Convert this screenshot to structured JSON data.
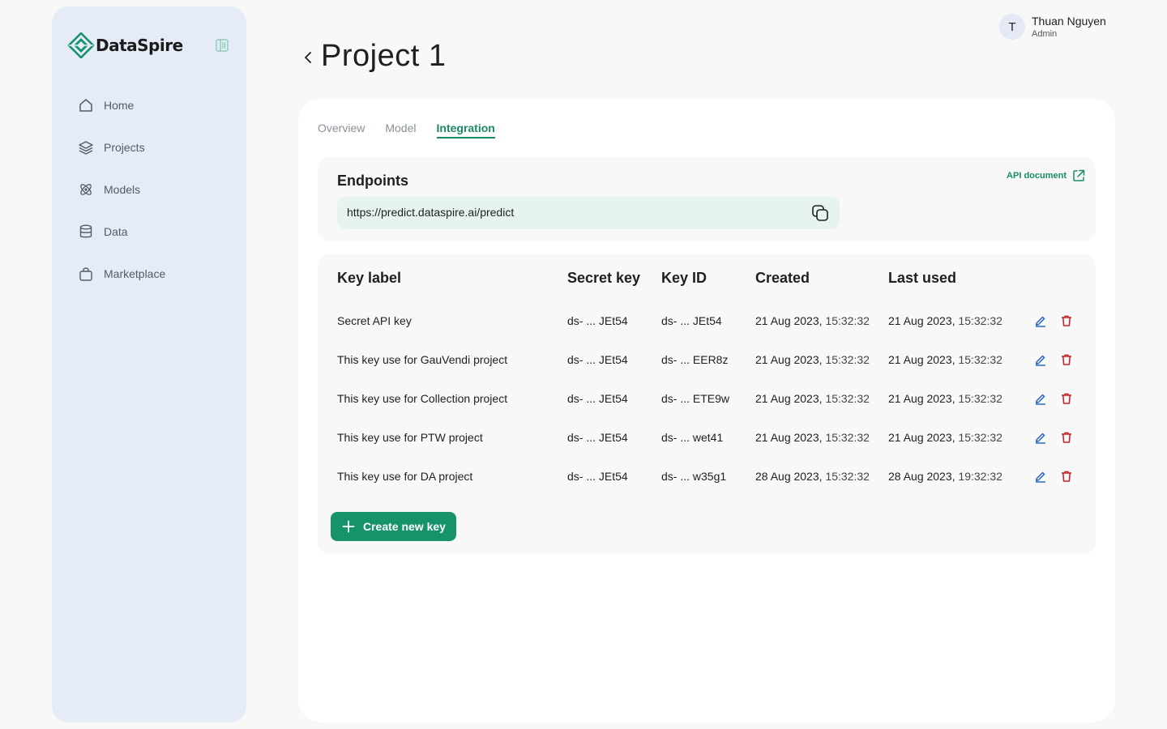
{
  "brand": {
    "name": "DataSpire",
    "accent": "#17936c",
    "danger": "#c62828",
    "link_blue": "#1e5fbf"
  },
  "sidebar": {
    "items": [
      {
        "label": "Home",
        "icon": "home-icon"
      },
      {
        "label": "Projects",
        "icon": "layers-icon"
      },
      {
        "label": "Models",
        "icon": "atom-icon"
      },
      {
        "label": "Data",
        "icon": "database-icon"
      },
      {
        "label": "Marketplace",
        "icon": "shopping-bag-icon"
      }
    ]
  },
  "header": {
    "title": "Project 1"
  },
  "user": {
    "initial": "T",
    "name": "Thuan Nguyen",
    "role": "Admin"
  },
  "tabs": [
    {
      "label": "Overview",
      "active": false
    },
    {
      "label": "Model",
      "active": false
    },
    {
      "label": "Integration",
      "active": true
    }
  ],
  "endpoints": {
    "title": "Endpoints",
    "url": "https://predict.dataspire.ai/predict",
    "api_doc_label": "API document"
  },
  "keys_table": {
    "headers": [
      "Key label",
      "Secret key",
      "Key ID",
      "Created",
      "Last used"
    ],
    "rows": [
      {
        "label": "Secret API key",
        "secret": "ds- ... JEt54",
        "key_id": "ds- ... JEt54",
        "created_date": "21 Aug 2023,",
        "created_time": "15:32:32",
        "used_date": "21 Aug 2023,",
        "used_time": "15:32:32"
      },
      {
        "label": "This key use for GauVendi project",
        "secret": "ds- ... JEt54",
        "key_id": "ds- ... EER8z",
        "created_date": "21 Aug 2023,",
        "created_time": "15:32:32",
        "used_date": "21 Aug 2023,",
        "used_time": "15:32:32"
      },
      {
        "label": "This key use for Collection project",
        "secret": "ds- ... JEt54",
        "key_id": "ds- ... ETE9w",
        "created_date": "21 Aug 2023,",
        "created_time": "15:32:32",
        "used_date": "21 Aug 2023,",
        "used_time": "15:32:32"
      },
      {
        "label": "This key use for PTW project",
        "secret": "ds- ... JEt54",
        "key_id": "ds- ... wet41",
        "created_date": "21 Aug 2023,",
        "created_time": "15:32:32",
        "used_date": "21 Aug 2023,",
        "used_time": "15:32:32"
      },
      {
        "label": "This key use for DA project",
        "secret": "ds- ... JEt54",
        "key_id": "ds- ... w35g1",
        "created_date": "28 Aug 2023,",
        "created_time": "15:32:32",
        "used_date": "28 Aug 2023,",
        "used_time": "19:32:32"
      }
    ]
  },
  "create_key_label": "Create new key"
}
